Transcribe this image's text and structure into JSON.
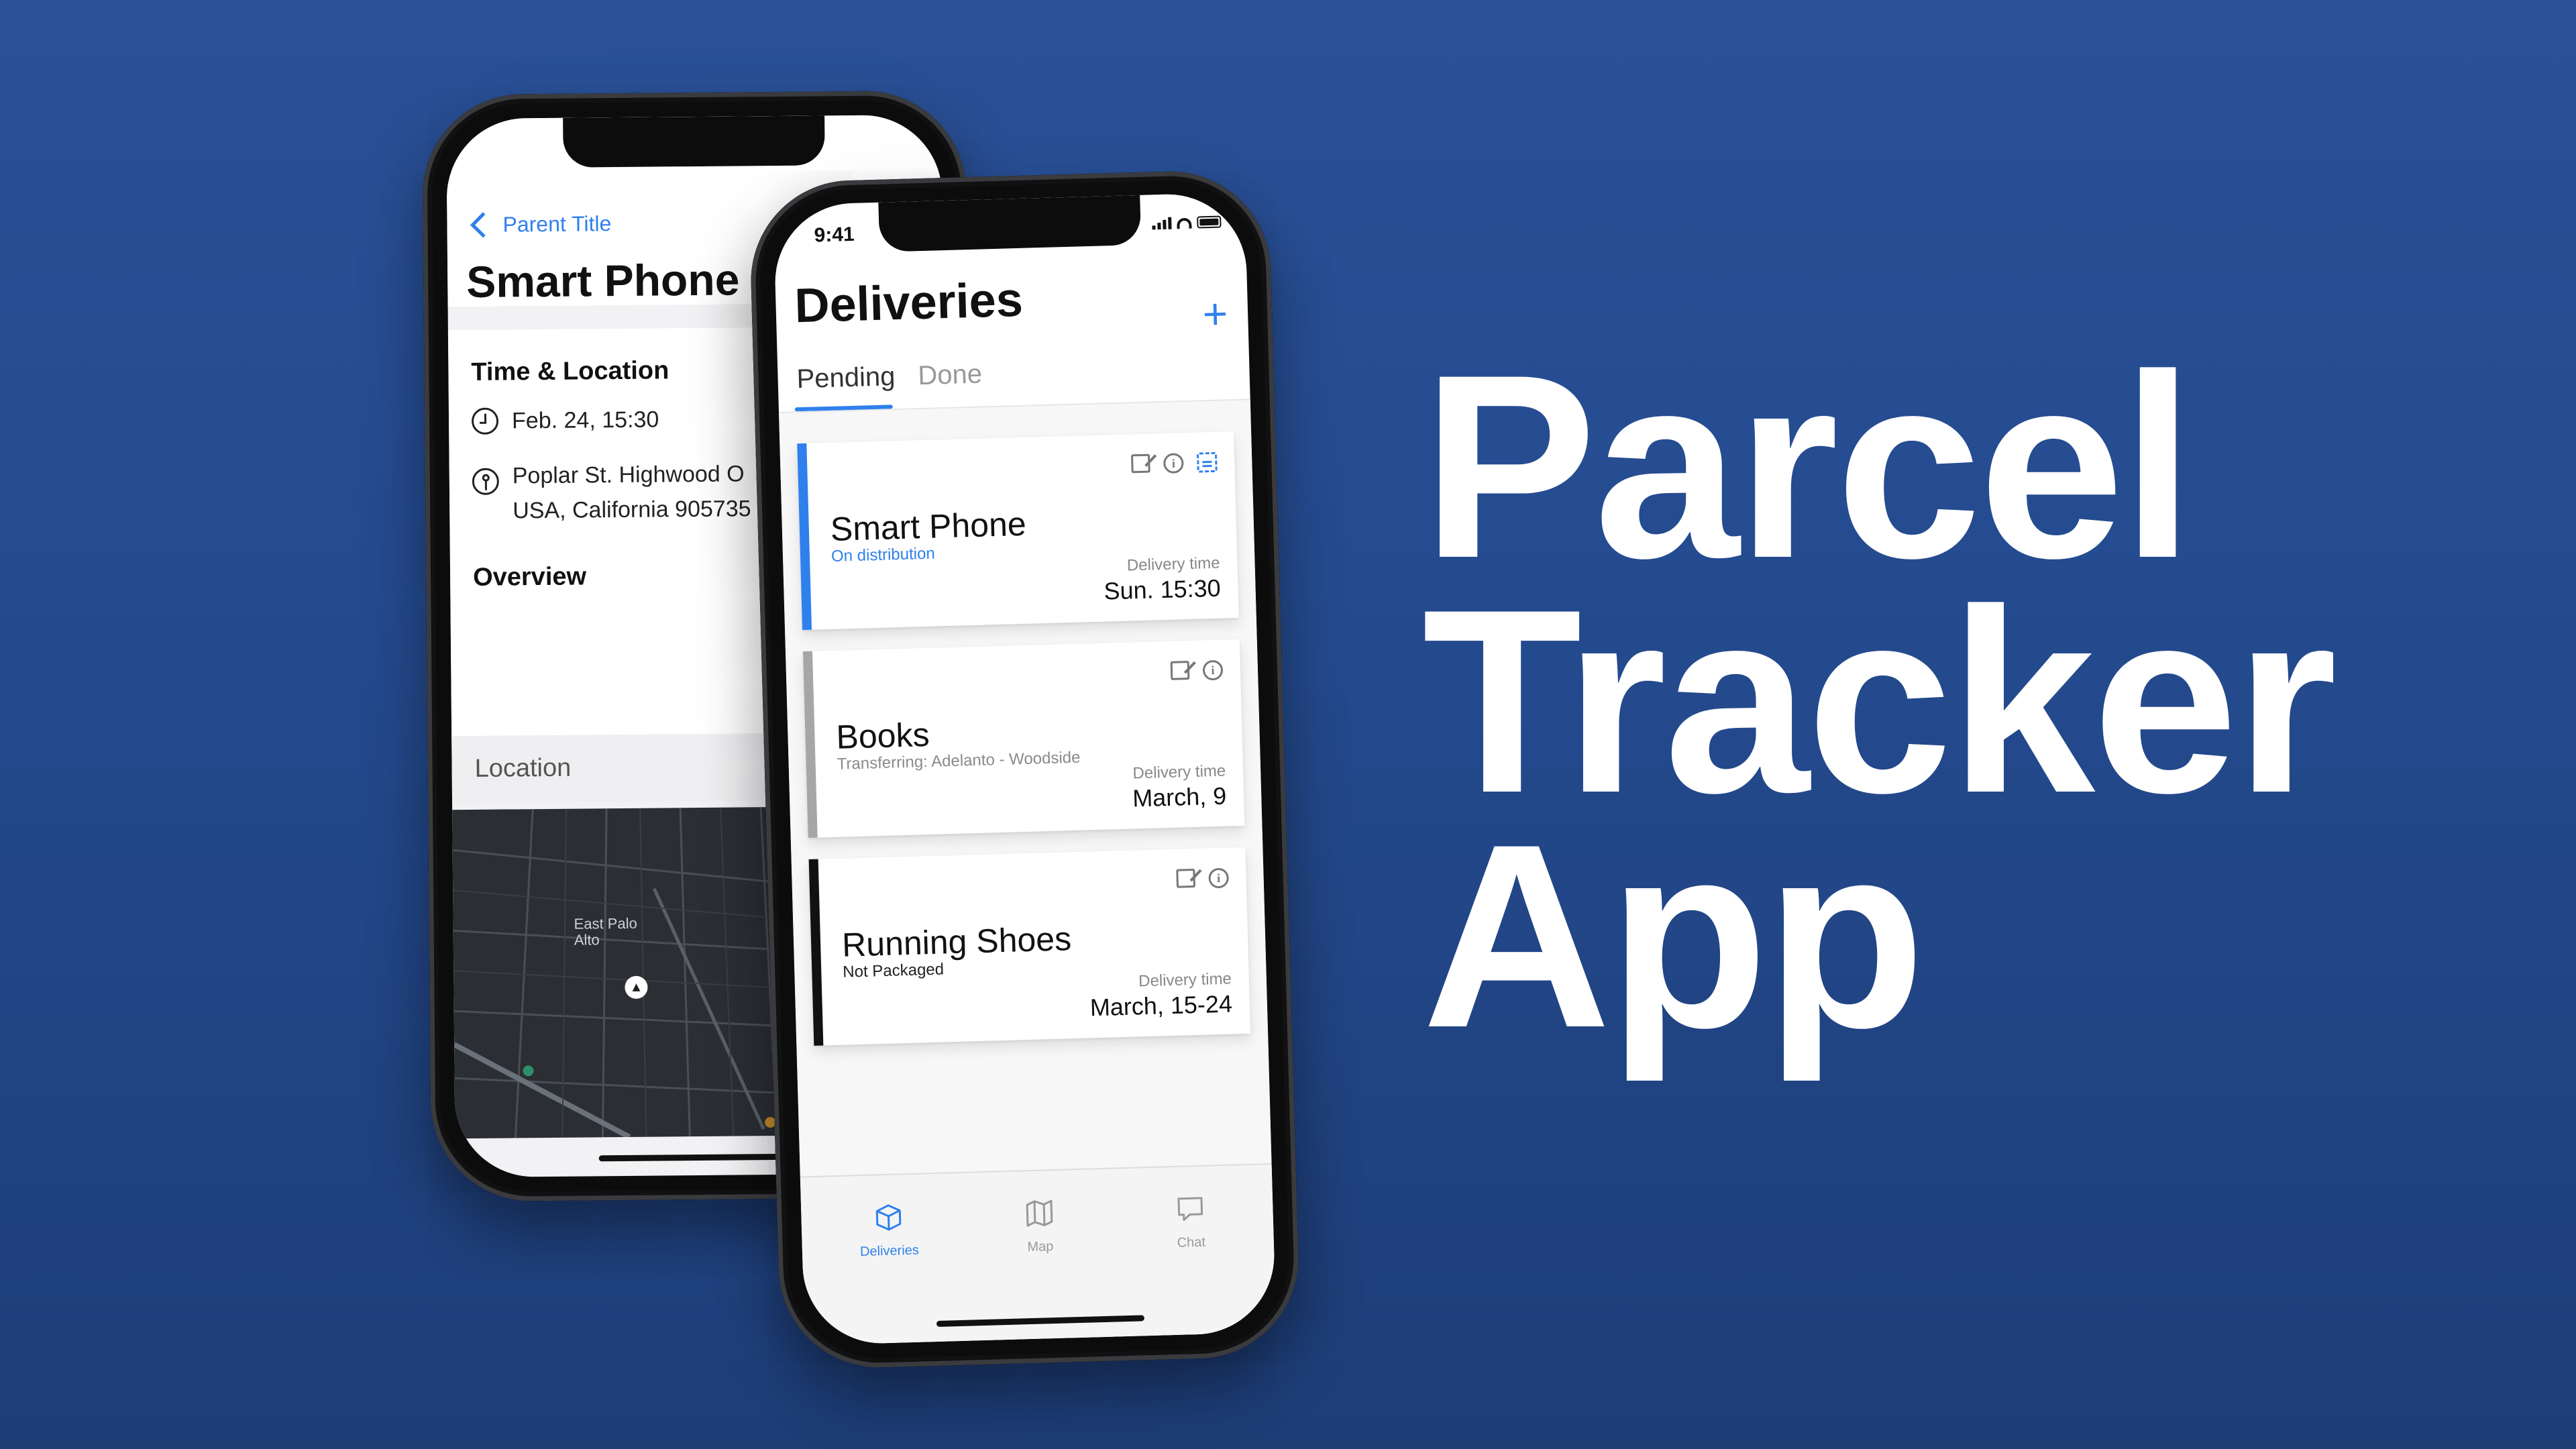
{
  "hero": {
    "line1": "Parcel",
    "line2": "Tracker",
    "line3": "App"
  },
  "detail_screen": {
    "back_label": "Parent Title",
    "title": "Smart Phone",
    "section_time_location": "Time & Location",
    "time_value": "Feb. 24, 15:30",
    "address_line1": "Poplar St. Highwood O",
    "address_line2": "USA, California 905735",
    "section_overview": "Overview",
    "section_location": "Location",
    "map_label_line1": "East Palo",
    "map_label_line2": "Alto"
  },
  "deliveries_screen": {
    "status_time": "9:41",
    "title": "Deliveries",
    "add_label": "+",
    "tabs": [
      {
        "label": "Pending"
      },
      {
        "label": "Done"
      }
    ],
    "cards": [
      {
        "name": "Smart Phone",
        "status": "On distribution",
        "delivery_time_label": "Delivery time",
        "delivery_time": "Sun. 15:30",
        "accent": "#2f80ed",
        "status_color": "#2f80ed"
      },
      {
        "name": "Books",
        "status": "Transferring: Adelanto - Woodside",
        "delivery_time_label": "Delivery time",
        "delivery_time": "March, 9",
        "accent": "#a6a6a6",
        "status_color": "#8a8a8a"
      },
      {
        "name": "Running Shoes",
        "status": "Not Packaged",
        "delivery_time_label": "Delivery time",
        "delivery_time": "March, 15-24",
        "accent": "#111111",
        "status_color": "#222222"
      }
    ],
    "tab_bar": [
      {
        "label": "Deliveries",
        "icon": "box-icon"
      },
      {
        "label": "Map",
        "icon": "map-icon"
      },
      {
        "label": "Chat",
        "icon": "chat-icon"
      }
    ]
  },
  "colors": {
    "background": "#244a8e",
    "accent": "#2f80ed"
  }
}
